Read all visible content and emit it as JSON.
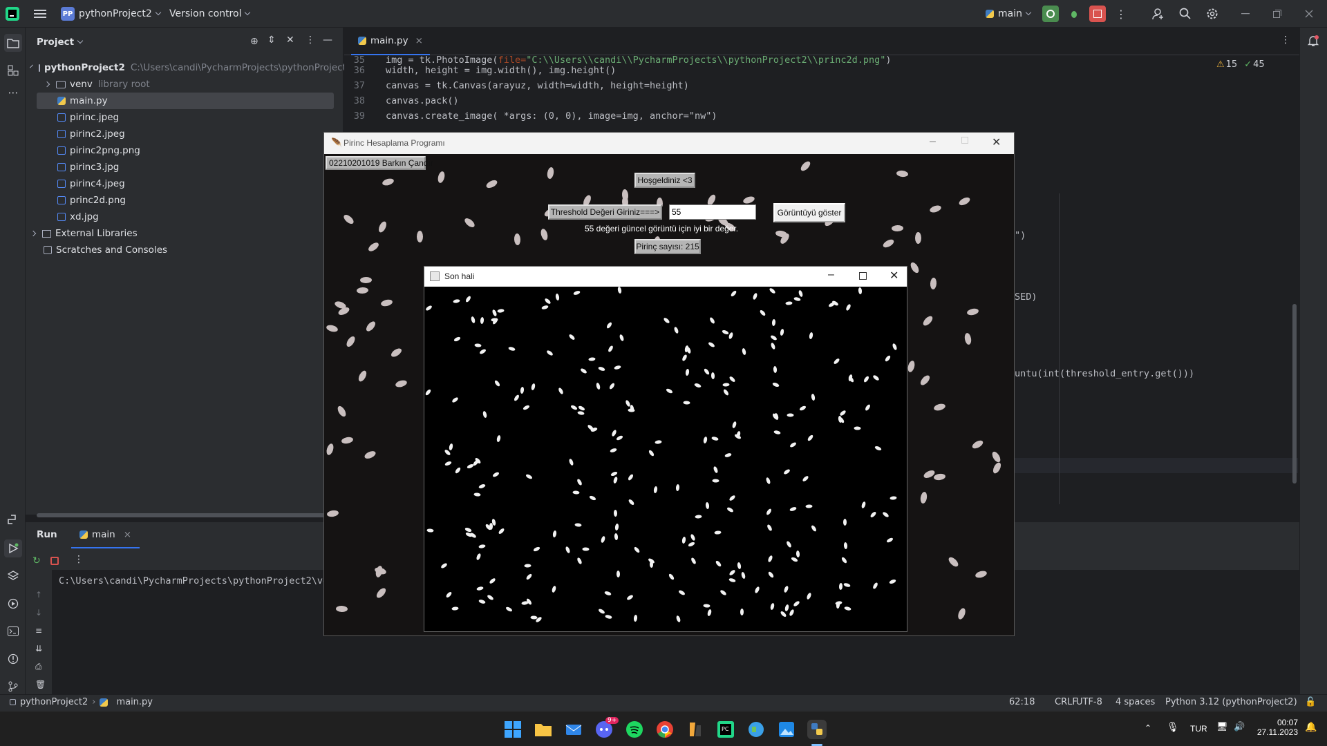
{
  "ide": {
    "project_badge": "PP",
    "project_name": "pythonProject2",
    "version_control": "Version control",
    "run_config": "main"
  },
  "project_panel": {
    "title": "Project",
    "root": {
      "name": "pythonProject2",
      "path": "C:\\Users\\candi\\PycharmProjects\\pythonProject2"
    },
    "items": [
      {
        "name": "venv",
        "note": "library root"
      },
      {
        "name": "main.py"
      },
      {
        "name": "pirinc.jpeg"
      },
      {
        "name": "pirinc2.jpeg"
      },
      {
        "name": "pirinc2png.png"
      },
      {
        "name": "pirinc3.jpg"
      },
      {
        "name": "pirinc4.jpeg"
      },
      {
        "name": "princ2d.png"
      },
      {
        "name": "xd.jpg"
      }
    ],
    "external_libraries": "External Libraries",
    "scratches": "Scratches and Consoles"
  },
  "editor": {
    "tab": "main.py",
    "warnings": "15",
    "weak_warnings": "45",
    "lines": [
      {
        "n": "36",
        "text": "width, height = img.width(), img.height()"
      },
      {
        "n": "37",
        "text": "canvas = tk.Canvas(arayuz, width=width, height=height)"
      },
      {
        "n": "38",
        "text": "canvas.pack()"
      },
      {
        "n": "39",
        "text": "canvas.create_image( *args: (0, 0), image=img, anchor=\"nw\")"
      }
    ],
    "fragments": {
      "frag1": "\")",
      "frag2": "SED)",
      "frag3": "untu(int(threshold_entry.get()))"
    }
  },
  "run_panel": {
    "tab_run": "Run",
    "tab_main": "main",
    "console_line": "C:\\Users\\candi\\PycharmProjects\\pythonProject2\\ve"
  },
  "status_bar": {
    "breadcrumb_project": "pythonProject2",
    "breadcrumb_file": "main.py",
    "position": "62:18",
    "line_sep": "CRLF",
    "encoding": "UTF-8",
    "indent": "4 spaces",
    "interpreter": "Python 3.12 (pythonProject2)"
  },
  "tk_app": {
    "title": "Pirinc Hesaplama Programı",
    "author_label": "02210201019 Barkın Çandır",
    "welcome_label": "Hoşgeldiniz <3",
    "threshold_label": "Threshold Değeri Giriniz===>",
    "threshold_value": "55",
    "show_button": "Görüntüyü göster",
    "hint": "55 değeri güncel görüntü için iyi bir değer.",
    "count_label": "Pirinç sayısı: 215"
  },
  "son_hali": {
    "title": "Son hali"
  },
  "taskbar": {
    "lang": "TUR",
    "time": "00:07",
    "date": "27.11.2023",
    "badge": "9+"
  }
}
